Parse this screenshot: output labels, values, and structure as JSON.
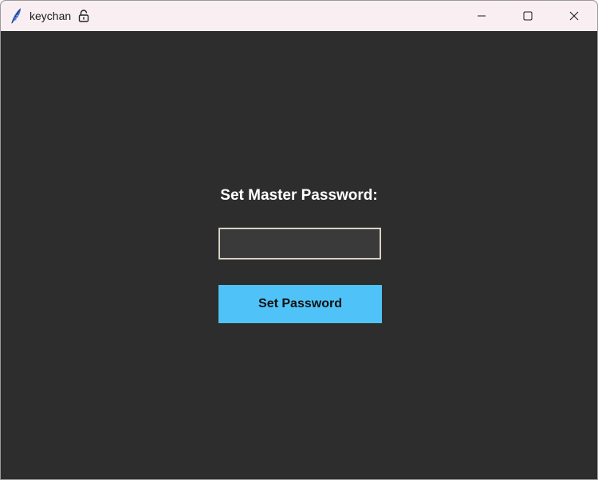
{
  "window": {
    "title": "keychan",
    "app_icon": "feather-icon",
    "title_icon": "unlocked-padlock-icon",
    "controls": {
      "minimize": "minimize-icon",
      "maximize": "maximize-icon",
      "close": "close-icon"
    }
  },
  "main": {
    "prompt_label": "Set Master Password:",
    "password_input": {
      "value": "",
      "placeholder": ""
    },
    "submit_label": "Set Password"
  },
  "colors": {
    "titlebar_bg": "#f9eff2",
    "content_bg": "#2d2d2d",
    "input_bg": "#3a3a3a",
    "input_border": "#d6d1c4",
    "button_bg": "#4fc3f7",
    "label_text": "#ffffff"
  }
}
